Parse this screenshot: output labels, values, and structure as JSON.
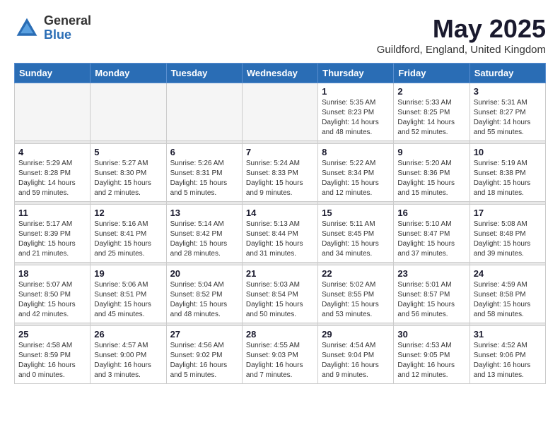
{
  "logo": {
    "general": "General",
    "blue": "Blue"
  },
  "header": {
    "month": "May 2025",
    "location": "Guildford, England, United Kingdom"
  },
  "weekdays": [
    "Sunday",
    "Monday",
    "Tuesday",
    "Wednesday",
    "Thursday",
    "Friday",
    "Saturday"
  ],
  "weeks": [
    [
      {
        "day": "",
        "empty": true
      },
      {
        "day": "",
        "empty": true
      },
      {
        "day": "",
        "empty": true
      },
      {
        "day": "",
        "empty": true
      },
      {
        "day": "1",
        "sunrise": "5:35 AM",
        "sunset": "8:23 PM",
        "daylight": "14 hours and 48 minutes."
      },
      {
        "day": "2",
        "sunrise": "5:33 AM",
        "sunset": "8:25 PM",
        "daylight": "14 hours and 52 minutes."
      },
      {
        "day": "3",
        "sunrise": "5:31 AM",
        "sunset": "8:27 PM",
        "daylight": "14 hours and 55 minutes."
      }
    ],
    [
      {
        "day": "4",
        "sunrise": "5:29 AM",
        "sunset": "8:28 PM",
        "daylight": "14 hours and 59 minutes."
      },
      {
        "day": "5",
        "sunrise": "5:27 AM",
        "sunset": "8:30 PM",
        "daylight": "15 hours and 2 minutes."
      },
      {
        "day": "6",
        "sunrise": "5:26 AM",
        "sunset": "8:31 PM",
        "daylight": "15 hours and 5 minutes."
      },
      {
        "day": "7",
        "sunrise": "5:24 AM",
        "sunset": "8:33 PM",
        "daylight": "15 hours and 9 minutes."
      },
      {
        "day": "8",
        "sunrise": "5:22 AM",
        "sunset": "8:34 PM",
        "daylight": "15 hours and 12 minutes."
      },
      {
        "day": "9",
        "sunrise": "5:20 AM",
        "sunset": "8:36 PM",
        "daylight": "15 hours and 15 minutes."
      },
      {
        "day": "10",
        "sunrise": "5:19 AM",
        "sunset": "8:38 PM",
        "daylight": "15 hours and 18 minutes."
      }
    ],
    [
      {
        "day": "11",
        "sunrise": "5:17 AM",
        "sunset": "8:39 PM",
        "daylight": "15 hours and 21 minutes."
      },
      {
        "day": "12",
        "sunrise": "5:16 AM",
        "sunset": "8:41 PM",
        "daylight": "15 hours and 25 minutes."
      },
      {
        "day": "13",
        "sunrise": "5:14 AM",
        "sunset": "8:42 PM",
        "daylight": "15 hours and 28 minutes."
      },
      {
        "day": "14",
        "sunrise": "5:13 AM",
        "sunset": "8:44 PM",
        "daylight": "15 hours and 31 minutes."
      },
      {
        "day": "15",
        "sunrise": "5:11 AM",
        "sunset": "8:45 PM",
        "daylight": "15 hours and 34 minutes."
      },
      {
        "day": "16",
        "sunrise": "5:10 AM",
        "sunset": "8:47 PM",
        "daylight": "15 hours and 37 minutes."
      },
      {
        "day": "17",
        "sunrise": "5:08 AM",
        "sunset": "8:48 PM",
        "daylight": "15 hours and 39 minutes."
      }
    ],
    [
      {
        "day": "18",
        "sunrise": "5:07 AM",
        "sunset": "8:50 PM",
        "daylight": "15 hours and 42 minutes."
      },
      {
        "day": "19",
        "sunrise": "5:06 AM",
        "sunset": "8:51 PM",
        "daylight": "15 hours and 45 minutes."
      },
      {
        "day": "20",
        "sunrise": "5:04 AM",
        "sunset": "8:52 PM",
        "daylight": "15 hours and 48 minutes."
      },
      {
        "day": "21",
        "sunrise": "5:03 AM",
        "sunset": "8:54 PM",
        "daylight": "15 hours and 50 minutes."
      },
      {
        "day": "22",
        "sunrise": "5:02 AM",
        "sunset": "8:55 PM",
        "daylight": "15 hours and 53 minutes."
      },
      {
        "day": "23",
        "sunrise": "5:01 AM",
        "sunset": "8:57 PM",
        "daylight": "15 hours and 56 minutes."
      },
      {
        "day": "24",
        "sunrise": "4:59 AM",
        "sunset": "8:58 PM",
        "daylight": "15 hours and 58 minutes."
      }
    ],
    [
      {
        "day": "25",
        "sunrise": "4:58 AM",
        "sunset": "8:59 PM",
        "daylight": "16 hours and 0 minutes."
      },
      {
        "day": "26",
        "sunrise": "4:57 AM",
        "sunset": "9:00 PM",
        "daylight": "16 hours and 3 minutes."
      },
      {
        "day": "27",
        "sunrise": "4:56 AM",
        "sunset": "9:02 PM",
        "daylight": "16 hours and 5 minutes."
      },
      {
        "day": "28",
        "sunrise": "4:55 AM",
        "sunset": "9:03 PM",
        "daylight": "16 hours and 7 minutes."
      },
      {
        "day": "29",
        "sunrise": "4:54 AM",
        "sunset": "9:04 PM",
        "daylight": "16 hours and 9 minutes."
      },
      {
        "day": "30",
        "sunrise": "4:53 AM",
        "sunset": "9:05 PM",
        "daylight": "16 hours and 12 minutes."
      },
      {
        "day": "31",
        "sunrise": "4:52 AM",
        "sunset": "9:06 PM",
        "daylight": "16 hours and 13 minutes."
      }
    ]
  ]
}
